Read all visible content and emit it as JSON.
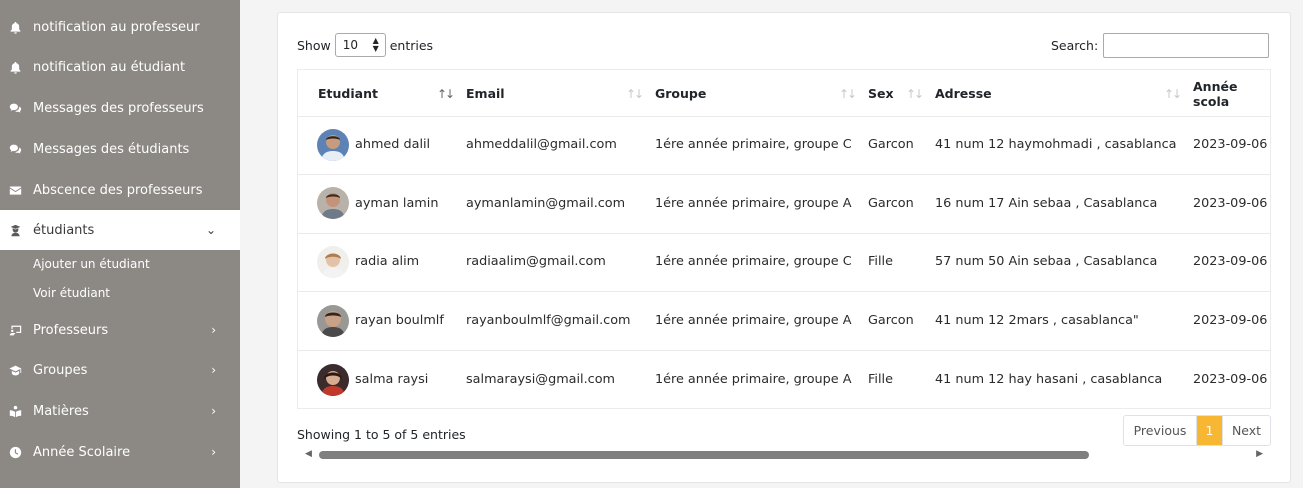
{
  "sidebar": {
    "items": [
      {
        "label": "notification au professeur",
        "icon": "bell-icon"
      },
      {
        "label": "notification au étudiant",
        "icon": "bell-icon"
      },
      {
        "label": "Messages des professeurs",
        "icon": "comments-icon"
      },
      {
        "label": "Messages des étudiants",
        "icon": "comments-icon"
      },
      {
        "label": "Abscence des professeurs",
        "icon": "envelope-icon"
      },
      {
        "label": "étudiants",
        "icon": "student-icon",
        "active": true,
        "expanded": true
      },
      {
        "label": "Professeurs",
        "icon": "chalkboard-icon"
      },
      {
        "label": "Groupes",
        "icon": "graduation-cap-icon"
      },
      {
        "label": "Matières",
        "icon": "book-reader-icon"
      },
      {
        "label": "Année Scolaire",
        "icon": "clock-icon"
      }
    ],
    "subitems": [
      "Ajouter un étudiant",
      "Voir étudiant"
    ]
  },
  "controls": {
    "show_label": "Show",
    "entries_value": "10",
    "entries_label": "entries",
    "search_label": "Search:",
    "search_value": ""
  },
  "table": {
    "columns": [
      "Etudiant",
      "Email",
      "Groupe",
      "Sex",
      "Adresse",
      "Année scola"
    ],
    "rows": [
      {
        "name": "ahmed dalil",
        "email": "ahmeddalil@gmail.com",
        "groupe": "1ére année primaire, groupe C",
        "sex": "Garcon",
        "adresse": "41 num 12 haymohmadi , casablanca",
        "annee": "2023-09-06"
      },
      {
        "name": "ayman lamin",
        "email": "aymanlamin@gmail.com",
        "groupe": "1ére année primaire, groupe A",
        "sex": "Garcon",
        "adresse": "16 num 17 Ain sebaa , Casablanca",
        "annee": "2023-09-06"
      },
      {
        "name": "radia alim",
        "email": "radiaalim@gmail.com",
        "groupe": "1ére année primaire, groupe C",
        "sex": "Fille",
        "adresse": "57 num 50 Ain sebaa , Casablanca",
        "annee": "2023-09-06"
      },
      {
        "name": "rayan boulmlf",
        "email": "rayanboulmlf@gmail.com",
        "groupe": "1ére année primaire, groupe A",
        "sex": "Garcon",
        "adresse": "41 num 12 2mars , casablanca\"",
        "annee": "2023-09-06"
      },
      {
        "name": "salma raysi",
        "email": "salmaraysi@gmail.com",
        "groupe": "1ére année primaire, groupe A",
        "sex": "Fille",
        "adresse": "41 num 12 hay hasani , casablanca",
        "annee": "2023-09-06"
      }
    ]
  },
  "footer": {
    "info": "Showing 1 to 5 of 5 entries",
    "prev": "Previous",
    "page": "1",
    "next": "Next"
  },
  "colors": {
    "sidebar": "#8c8985",
    "accent": "#f7b733"
  }
}
